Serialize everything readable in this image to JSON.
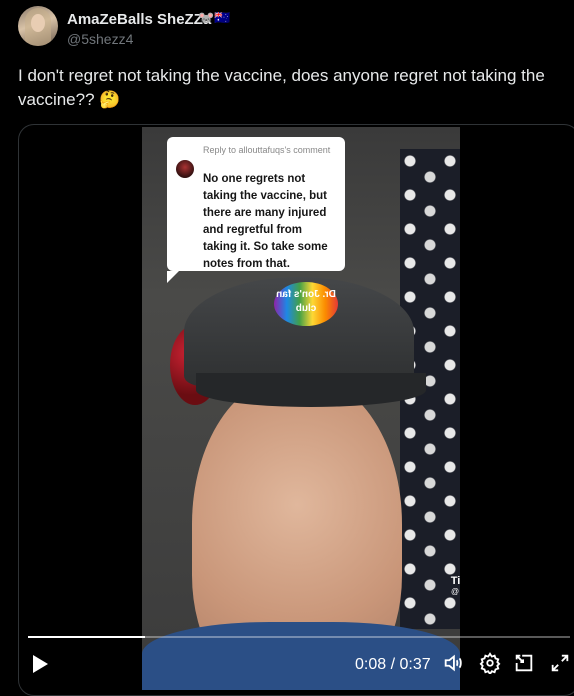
{
  "tweet": {
    "author_name": "AmaZeBalls SheZZa",
    "author_emojis": "🐭🇦🇺",
    "handle": "@5shezz4",
    "text": "I don't regret not taking the vaccine, does anyone regret not taking the vaccine?? 🤔"
  },
  "video": {
    "reply_header": "Reply to allouttafuqs's comment",
    "reply_text": "No one regrets not taking the vaccine, but there are many injured and regretful from taking it. So take some notes from that.",
    "pin_text": "Dr. Jon's fan club",
    "watermark_logo": "♪",
    "watermark_brand": "TikTok",
    "watermark_user": "@ dr.jon.l",
    "progress_fraction": 0.216,
    "time_display": "0:08 / 0:37"
  }
}
